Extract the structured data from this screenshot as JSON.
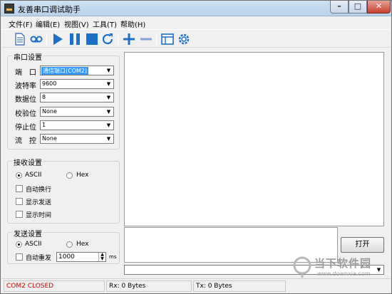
{
  "window": {
    "title": "友善串口调试助手"
  },
  "menu": [
    "文件(F)",
    "编辑(E)",
    "视图(V)",
    "工具(T)",
    "帮助(H)"
  ],
  "toolbar": {
    "icons": [
      "new-document-icon",
      "record-icon",
      "play-icon",
      "pause-icon",
      "stop-icon",
      "refresh-icon",
      "add-icon",
      "remove-icon",
      "window-icon",
      "settings-icon"
    ],
    "accent": "#1a6fc7"
  },
  "serial_settings": {
    "title": "串口设置",
    "fields": [
      {
        "label": "端　口",
        "value": "通信端口(COM2)"
      },
      {
        "label": "波特率",
        "value": "9600"
      },
      {
        "label": "数据位",
        "value": "8"
      },
      {
        "label": "校验位",
        "value": "None"
      },
      {
        "label": "停止位",
        "value": "1"
      },
      {
        "label": "流　控",
        "value": "None"
      }
    ]
  },
  "receive_settings": {
    "title": "接收设置",
    "mode_ascii": "ASCII",
    "mode_hex": "Hex",
    "options": [
      "自动换行",
      "显示发送",
      "显示时间"
    ]
  },
  "send_settings": {
    "title": "发送设置",
    "mode_ascii": "ASCII",
    "mode_hex": "Hex",
    "auto_resend_label": "自动重发",
    "interval_value": "1000",
    "interval_unit": "ms"
  },
  "open_button": "打开",
  "status": {
    "port": "COM2 CLOSED",
    "rx": "Rx: 0 Bytes",
    "tx": "Tx: 0 Bytes",
    "port_color": "#cc0000"
  },
  "watermark": {
    "text": "当下软件园",
    "sub": "www.downxia.com"
  }
}
